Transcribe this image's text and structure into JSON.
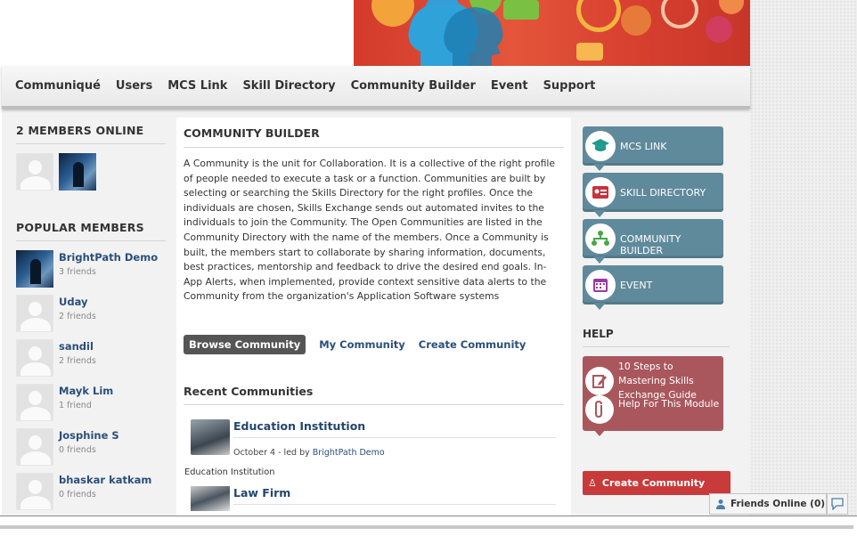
{
  "nav": {
    "items": [
      "Communiqué",
      "Users",
      "MCS Link",
      "Skill Directory",
      "Community Builder",
      "Event",
      "Support"
    ]
  },
  "members_online": {
    "title": "2 MEMBERS ONLINE"
  },
  "popular": {
    "title": "POPULAR MEMBERS",
    "members": [
      {
        "name": "BrightPath Demo",
        "friends": "3 friends"
      },
      {
        "name": "Uday",
        "friends": "2 friends"
      },
      {
        "name": "sandil",
        "friends": "2 friends"
      },
      {
        "name": "Mayk Lim",
        "friends": "1 friend"
      },
      {
        "name": "Josphine S",
        "friends": "0 friends"
      },
      {
        "name": "bhaskar katkam",
        "friends": "0 friends"
      }
    ]
  },
  "main": {
    "title": "COMMUNITY BUILDER",
    "description": "A Community is the unit for Collaboration. It is a collective of the right profile of people needed to execute a task or a function. Communities are built by selecting or searching the Skills Directory for the right profiles. Once the individuals are chosen, Skills Exchange sends out automated invites to the individuals to join the Community. The Open Communities are listed in the Community Directory with the name of the members. Once a Community is built, the members start to collaborate by sharing information, documents, best practices, mentorship and feedback to drive the desired end goals. In-App Alerts, when implemented, provide context sensitive data alerts to the Community from the organization's Application Software systems",
    "tabs": [
      "Browse Community",
      "My Community",
      "Create Community"
    ],
    "recent_title": "Recent Communities",
    "communities": [
      {
        "name": "Education Institution",
        "date": "October 4 - led by ",
        "leader": "BrightPath Demo",
        "category": "Education Institution"
      },
      {
        "name": "Law Firm"
      }
    ]
  },
  "quick_links": [
    "MCS LINK",
    "SKILL DIRECTORY",
    "COMMUNITY BUILDER",
    "EVENT"
  ],
  "help": {
    "title": "HELP",
    "items": [
      "10 Steps to Mastering Skills Exchange Guide",
      "Help For This Module"
    ]
  },
  "create_button": "Create Community",
  "friends_online": "Friends Online (0)",
  "colors": {
    "quick_link_bg": "#5f8a9c",
    "help_bg": "#a9575d",
    "create_bg": "#c93a3a",
    "link": "#2a4f7a"
  }
}
